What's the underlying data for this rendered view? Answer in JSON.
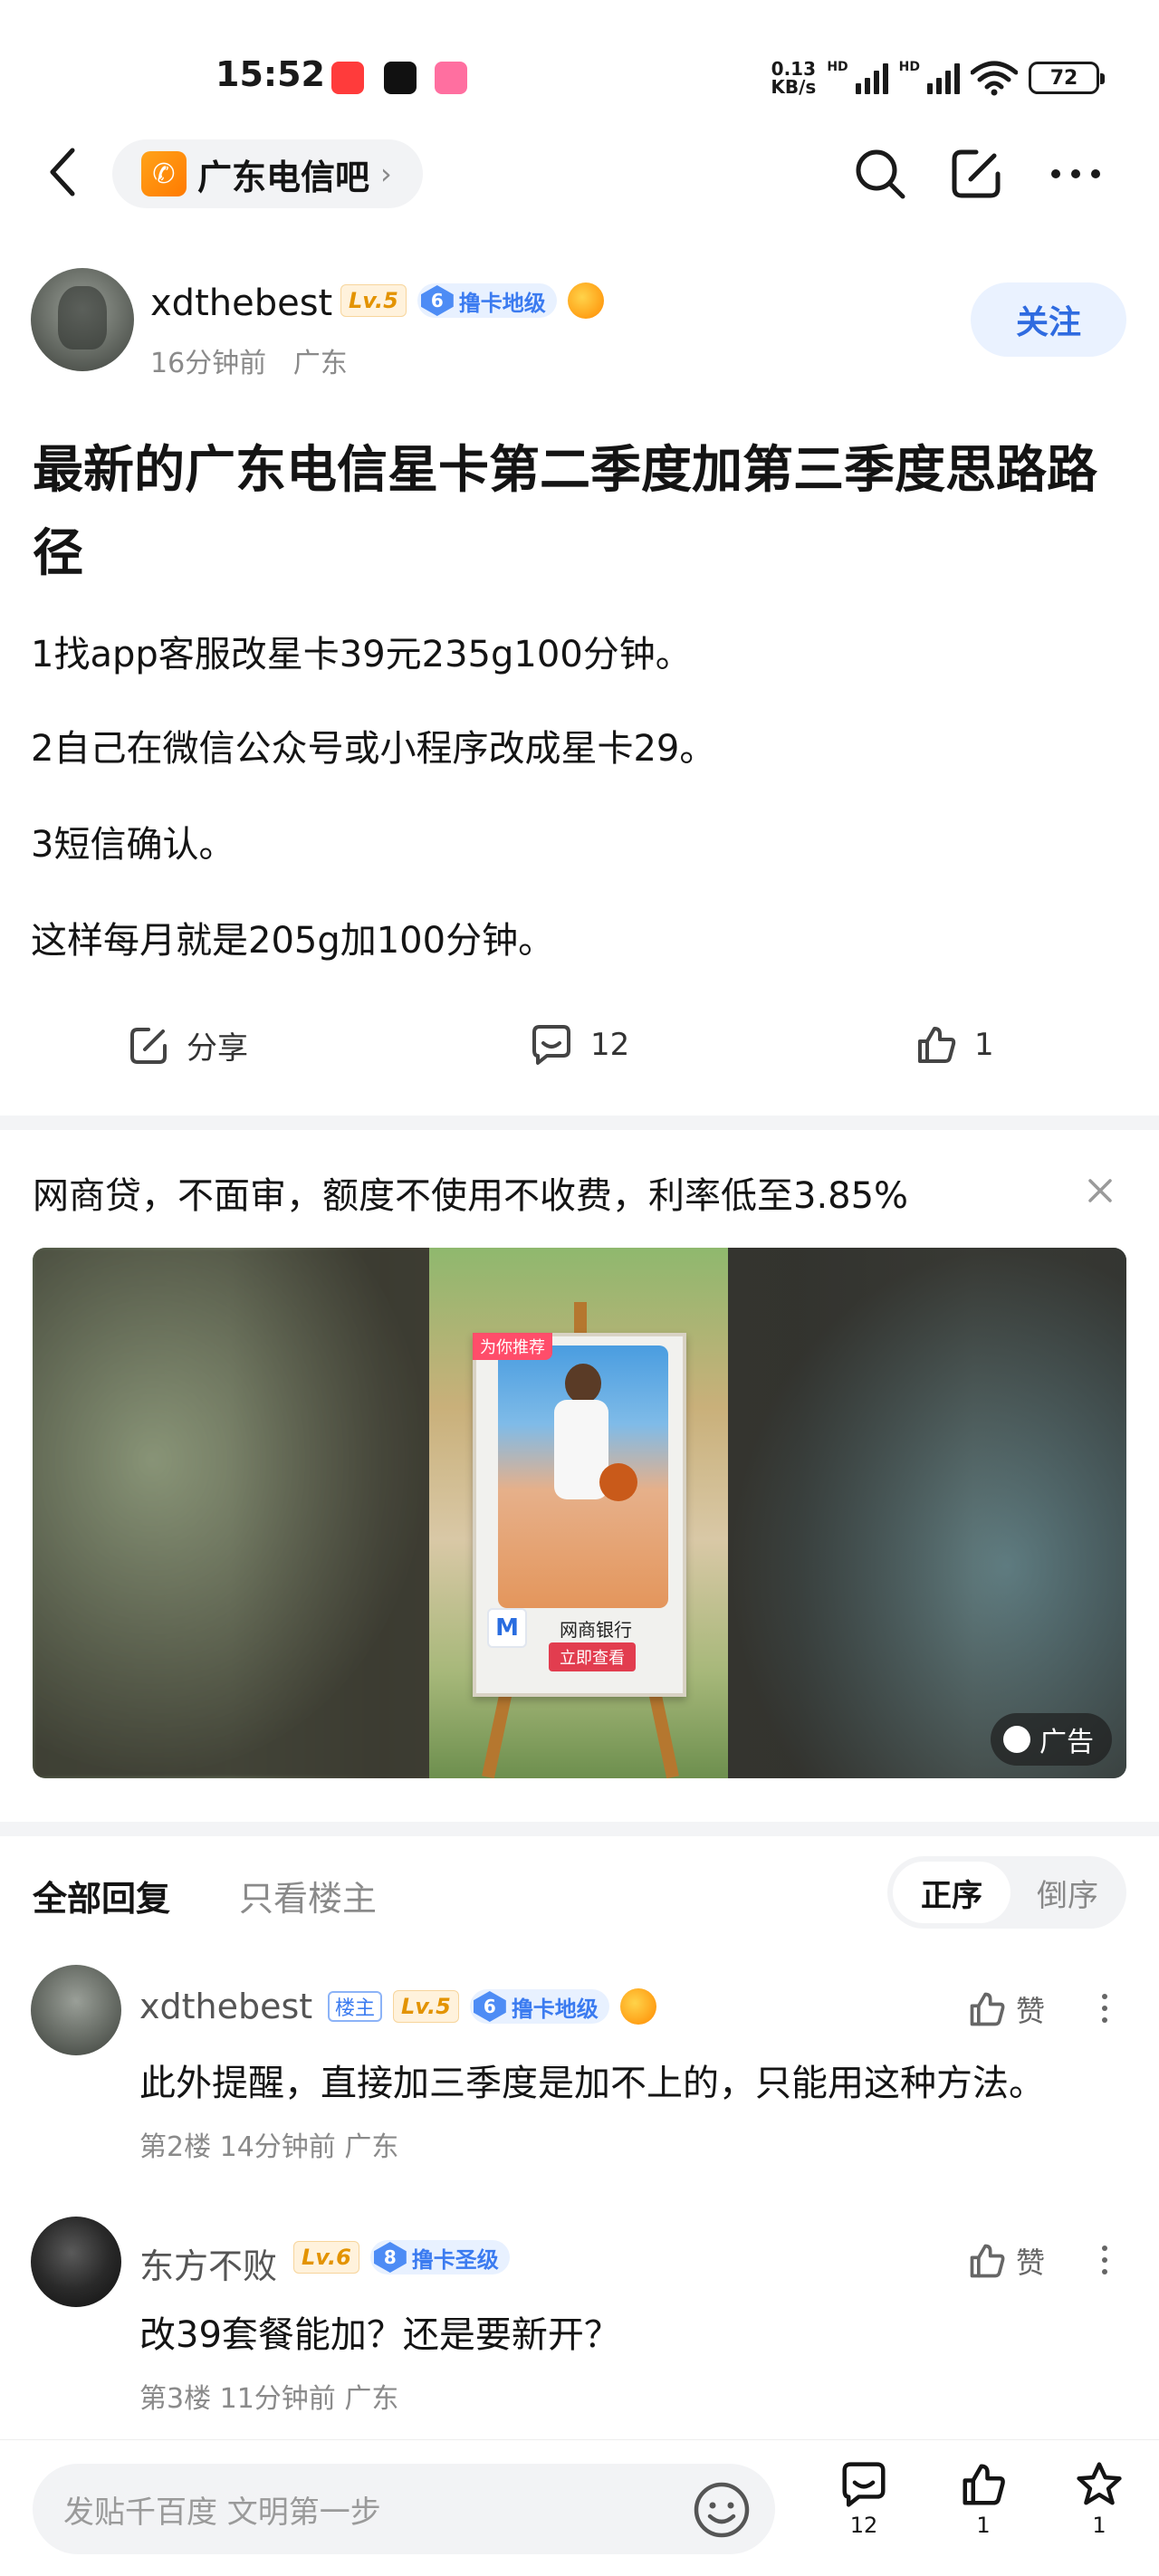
{
  "status_bar": {
    "time": "15:52",
    "net_speed_top": "0.13",
    "net_speed_bottom": "KB/s",
    "hd1": "HD",
    "hd2": "HD",
    "battery": "72",
    "wifi_sub": "6"
  },
  "nav": {
    "forum_name": "广东电信吧",
    "forum_chevron": "›",
    "icons": [
      "back-icon",
      "search-icon",
      "edit-icon",
      "more-icon"
    ]
  },
  "post": {
    "author": "xdthebest",
    "level": "Lv.5",
    "rank_num": "6",
    "rank_title": "撸卡地级",
    "time": "16分钟前",
    "location": "广东",
    "follow_label": "关注",
    "title": "最新的广东电信星卡第二季度加第三季度思路路径",
    "lines": [
      "1找app客服改星卡39元235g100分钟。",
      "2自己在微信公众号或小程序改成星卡29。",
      "3短信确认。",
      "这样每月就是205g加100分钟。"
    ],
    "share_label": "分享",
    "comment_count": "12",
    "like_count": "1"
  },
  "ad": {
    "title": "网商贷，不面审，额度不使用不收费，利率低至3.85%",
    "top_tag": "为你推荐",
    "bank_name": "网商银行",
    "cta": "立即查看",
    "label": "广告"
  },
  "replies_header": {
    "tab_all": "全部回复",
    "tab_op": "只看楼主",
    "order_asc": "正序",
    "order_desc": "倒序"
  },
  "replies": [
    {
      "author": "xdthebest",
      "op_tag": "楼主",
      "level": "Lv.5",
      "rank_num": "6",
      "rank_title": "撸卡地级",
      "text": "此外提醒，直接加三季度是加不上的，只能用这种方法。",
      "meta": "第2楼  14分钟前  广东",
      "like_label": "赞"
    },
    {
      "author": "东方不败",
      "level": "Lv.6",
      "rank_num": "8",
      "rank_title": "撸卡圣级",
      "text": "改39套餐能加？还是要新开？",
      "meta": "第3楼  11分钟前  广东",
      "like_label": "赞"
    }
  ],
  "bottom_bar": {
    "input_placeholder": "发贴千百度 文明第一步",
    "comment_count": "12",
    "like_count": "1",
    "star_count": "1"
  },
  "colors": {
    "accent_blue": "#2f6be0",
    "level_gold": "#e39300",
    "rank_blue": "#3b7bf0",
    "ad_cta_red": "#e23d4f"
  }
}
